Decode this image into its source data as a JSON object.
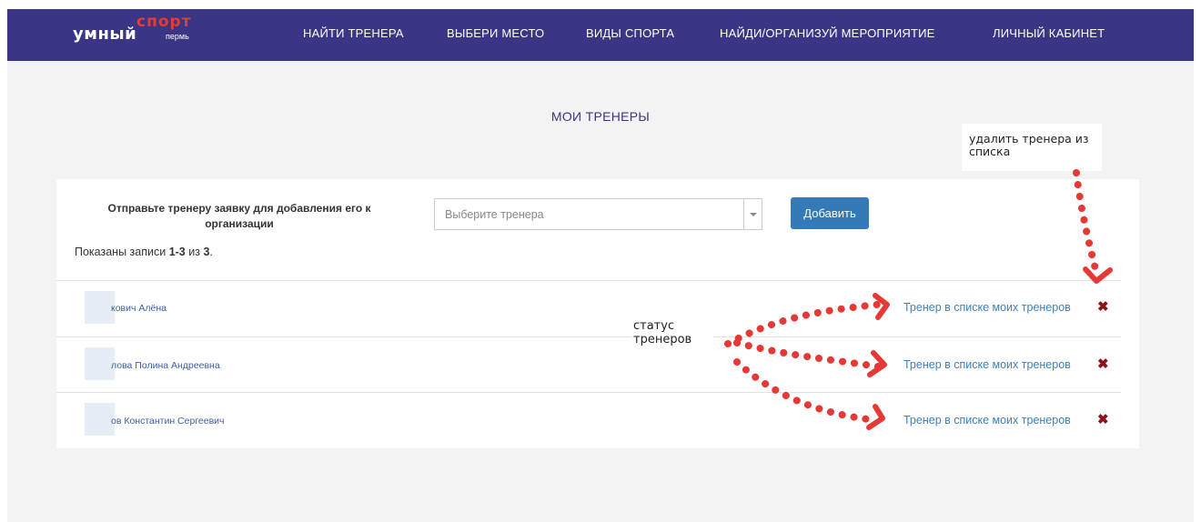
{
  "logo": {
    "main": "умный",
    "accent": "спорт",
    "city": "пермь"
  },
  "nav": [
    "НАЙТИ ТРЕНЕРА",
    "ВЫБЕРИ МЕСТО",
    "ВИДЫ СПОРТА",
    "НАЙДИ/ОРГАНИЗУЙ МЕРОПРИЯТИЕ",
    "ЛИЧНЫЙ КАБИНЕТ"
  ],
  "page": {
    "title": "МОИ ТРЕНЕРЫ"
  },
  "form": {
    "send_label": "Отправьте тренеру заявку для добавления его к организации",
    "select_placeholder": "Выберите тренера",
    "add_button": "Добавить"
  },
  "summary": {
    "prefix": "Показаны записи ",
    "range": "1-3",
    "middle": " из ",
    "total": "3",
    "suffix": "."
  },
  "trainers": [
    {
      "name": "кович Алёна",
      "status": "Тренер в списке моих тренеров"
    },
    {
      "name": "лова Полина Андреевна",
      "status": "Тренер в списке моих тренеров"
    },
    {
      "name": "ов Константин Сергеевич",
      "status": "Тренер в списке моих тренеров"
    }
  ],
  "annotations": {
    "remove_tip": "удалить тренера из списка",
    "status_tip": "статус тренеров"
  },
  "icons": {
    "remove": "close-icon",
    "dropdown": "chevron-down-icon"
  },
  "colors": {
    "nav_bg": "#3b3585",
    "brand_red": "#e53a36",
    "button": "#337ab7",
    "link": "#3d80c0",
    "remove": "#8b1418",
    "annotation": "#e53935"
  }
}
